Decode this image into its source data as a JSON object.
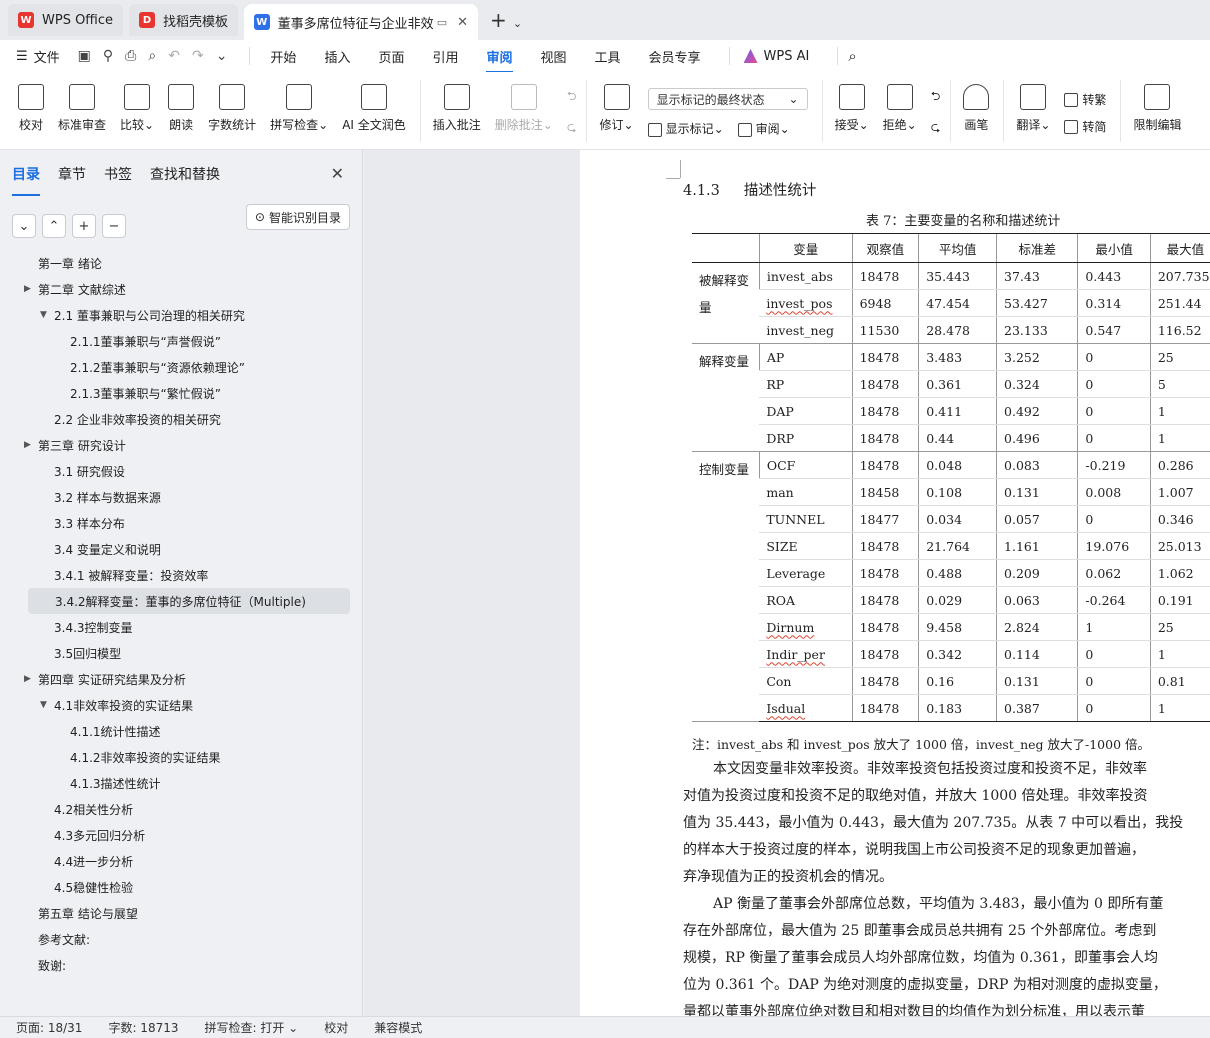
{
  "tabs": [
    {
      "label": "WPS Office",
      "logo": "W",
      "logo_color": "#e8352f"
    },
    {
      "label": "找稻壳模板",
      "logo": "D",
      "logo_color": "#e8352f"
    },
    {
      "label": "董事多席位特征与企业非效率",
      "logo": "W",
      "logo_color": "#2f6fe8"
    }
  ],
  "menu": {
    "file": "文件",
    "items": [
      "开始",
      "插入",
      "页面",
      "引用",
      "审阅",
      "视图",
      "工具",
      "会员专享"
    ],
    "active": "审阅",
    "wps_ai": "WPS AI"
  },
  "ribbon": {
    "proof": "校对",
    "standard_review": "标准审查",
    "compare": "比较",
    "read_aloud": "朗读",
    "word_count": "字数统计",
    "spell_check": "拼写检查",
    "ai_proof": "AI 全文润色",
    "insert_comment": "插入批注",
    "delete_comment": "删除批注",
    "revise": "修订",
    "markup_mode": "显示标记的最终状态",
    "show_markup": "显示标记",
    "review": "审阅",
    "accept": "接受",
    "reject": "拒绝",
    "pen": "画笔",
    "translate": "翻译",
    "to_traditional": "转繁",
    "to_simplified": "转简",
    "restrict_edit": "限制编辑"
  },
  "nav": {
    "tabs": [
      "目录",
      "章节",
      "书签",
      "查找和替换"
    ],
    "smart_toc": "智能识别目录",
    "toc": [
      {
        "label": "第一章  绪论",
        "level": 0,
        "arrow": ""
      },
      {
        "label": "第二章  文献综述",
        "level": 0,
        "arrow": "▶"
      },
      {
        "label": "2.1  董事兼职与公司治理的相关研究",
        "level": 1,
        "arrow": "▼"
      },
      {
        "label": "2.1.1董事兼职与“声誉假说”",
        "level": 2,
        "arrow": ""
      },
      {
        "label": "2.1.2董事兼职与“资源依赖理论”",
        "level": 2,
        "arrow": ""
      },
      {
        "label": "2.1.3董事兼职与“繁忙假说”",
        "level": 2,
        "arrow": ""
      },
      {
        "label": "2.2  企业非效率投资的相关研究",
        "level": 1,
        "arrow": ""
      },
      {
        "label": "第三章  研究设计",
        "level": 0,
        "arrow": "▶"
      },
      {
        "label": "3.1  研究假设",
        "level": 1,
        "arrow": ""
      },
      {
        "label": "3.2  样本与数据来源",
        "level": 1,
        "arrow": ""
      },
      {
        "label": "3.3  样本分布",
        "level": 1,
        "arrow": ""
      },
      {
        "label": "3.4  变量定义和说明",
        "level": 1,
        "arrow": ""
      },
      {
        "label": "3.4.1  被解释变量：投资效率",
        "level": 1,
        "arrow": ""
      },
      {
        "label": "3.4.2解释变量：董事的多席位特征（Multiple)",
        "level": 1,
        "arrow": "",
        "selected": true
      },
      {
        "label": "3.4.3控制变量",
        "level": 1,
        "arrow": ""
      },
      {
        "label": "3.5回归模型",
        "level": 1,
        "arrow": ""
      },
      {
        "label": "第四章  实证研究结果及分析",
        "level": 0,
        "arrow": "▶"
      },
      {
        "label": "4.1非效率投资的实证结果",
        "level": 1,
        "arrow": "▼"
      },
      {
        "label": "4.1.1统计性描述",
        "level": 2,
        "arrow": ""
      },
      {
        "label": "4.1.2非效率投资的实证结果",
        "level": 2,
        "arrow": ""
      },
      {
        "label": "4.1.3描述性统计",
        "level": 2,
        "arrow": ""
      },
      {
        "label": "4.2相关性分析",
        "level": 1,
        "arrow": ""
      },
      {
        "label": "4.3多元回归分析",
        "level": 1,
        "arrow": ""
      },
      {
        "label": "4.4进一步分析",
        "level": 1,
        "arrow": ""
      },
      {
        "label": "4.5稳健性检验",
        "level": 1,
        "arrow": ""
      },
      {
        "label": "第五章  结论与展望",
        "level": 0,
        "arrow": ""
      },
      {
        "label": "参考文献:",
        "level": 0,
        "arrow": ""
      },
      {
        "label": "致谢:",
        "level": 0,
        "arrow": ""
      }
    ]
  },
  "document": {
    "section_number": "4.1.3",
    "section_title": "描述性统计",
    "table_caption": "表 7：主要变量的名称和描述统计",
    "table_headers": [
      "",
      "变量",
      "观察值",
      "平均值",
      "标准差",
      "最小值",
      "最大值"
    ],
    "groups": [
      {
        "name": "被解释变量",
        "rows": [
          [
            "invest_abs",
            "18478",
            "35.443",
            "37.43",
            "0.443",
            "207.735"
          ],
          [
            "invest_pos",
            "6948",
            "47.454",
            "53.427",
            "0.314",
            "251.44"
          ],
          [
            "invest_neg",
            "11530",
            "28.478",
            "23.133",
            "0.547",
            "116.52"
          ]
        ]
      },
      {
        "name": "解释变量",
        "rows": [
          [
            "AP",
            "18478",
            "3.483",
            "3.252",
            "0",
            "25"
          ],
          [
            "RP",
            "18478",
            "0.361",
            "0.324",
            "0",
            "5"
          ],
          [
            "DAP",
            "18478",
            "0.411",
            "0.492",
            "0",
            "1"
          ],
          [
            "DRP",
            "18478",
            "0.44",
            "0.496",
            "0",
            "1"
          ]
        ]
      },
      {
        "name": "控制变量",
        "rows": [
          [
            "OCF",
            "18478",
            "0.048",
            "0.083",
            "-0.219",
            "0.286"
          ],
          [
            "man",
            "18458",
            "0.108",
            "0.131",
            "0.008",
            "1.007"
          ],
          [
            "TUNNEL",
            "18477",
            "0.034",
            "0.057",
            "0",
            "0.346"
          ],
          [
            "SIZE",
            "18478",
            "21.764",
            "1.161",
            "19.076",
            "25.013"
          ],
          [
            "Leverage",
            "18478",
            "0.488",
            "0.209",
            "0.062",
            "1.062"
          ],
          [
            "ROA",
            "18478",
            "0.029",
            "0.063",
            "-0.264",
            "0.191"
          ],
          [
            "Dirnum",
            "18478",
            "9.458",
            "2.824",
            "1",
            "25"
          ],
          [
            "Indir_per",
            "18478",
            "0.342",
            "0.114",
            "0",
            "1"
          ],
          [
            "Con",
            "18478",
            "0.16",
            "0.131",
            "0",
            "0.81"
          ],
          [
            "Isdual",
            "18478",
            "0.183",
            "0.387",
            "0",
            "1"
          ]
        ]
      }
    ],
    "note": "注：invest_abs 和 invest_pos 放大了 1000 倍，invest_neg 放大了-1000 倍。",
    "paragraph1": [
      "本文因变量非效率投资。非效率投资包括投资过度和投资不足，非效率",
      "对值为投资过度和投资不足的取绝对值，并放大 1000 倍处理。非效率投资",
      "值为 35.443，最小值为 0.443，最大值为 207.735。从表 7 中可以看出，我投",
      "的样本大于投资过度的样本，说明我国上市公司投资不足的现象更加普遍，",
      "弃净现值为正的投资机会的情况。"
    ],
    "paragraph2": [
      "AP 衡量了董事会外部席位总数，平均值为 3.483，最小值为 0 即所有董",
      "存在外部席位，最大值为 25 即董事会成员总共拥有 25 个外部席位。考虑到",
      "规模，RP 衡量了董事会成员人均外部席位数，均值为 0.361，即董事会人均",
      "位为 0.361 个。DAP 为绝对测度的虚拟变量，DRP 为相对测度的虚拟变量，",
      "量都以董事外部席位绝对数目和相对数目的均值作为划分标准，用以表示董"
    ]
  },
  "status": {
    "page": "页面: 18/31",
    "words": "字数: 18713",
    "spell": "拼写检查: 打开",
    "proof": "校对",
    "compat": "兼容模式"
  }
}
